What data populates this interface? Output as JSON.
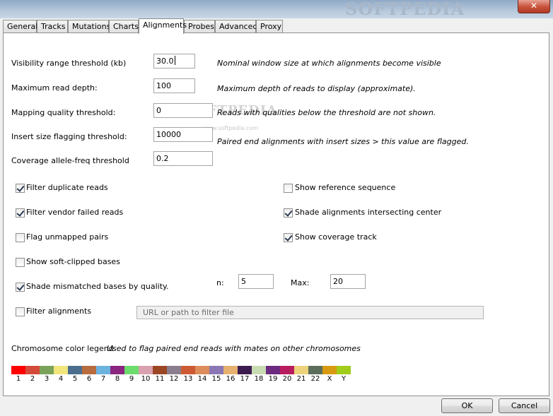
{
  "window": {
    "close_label": "✕",
    "watermark": "SOFTPEDIA"
  },
  "tabs": [
    "General",
    "Tracks",
    "Mutations",
    "Charts",
    "Alignments",
    "Probes",
    "Advanced",
    "Proxy"
  ],
  "active_tab": "Alignments",
  "fields": [
    {
      "label": "Visibility range threshold (kb)",
      "value": "30.0",
      "desc": "Nominal window size at which alignments become visible"
    },
    {
      "label": "Maximum read depth:",
      "value": "100",
      "desc": "Maximum depth of reads to display (approximate)."
    },
    {
      "label": "Mapping quality threshold:",
      "value": "0",
      "desc": "Reads with qualities below the threshold are not shown."
    },
    {
      "label": "Insert size flagging threshold:",
      "value": "10000",
      "desc": "Paired end alignments with insert sizes > this value are flagged."
    },
    {
      "label": "Coverage allele-freq threshold",
      "value": "0.2",
      "desc": ""
    }
  ],
  "checkboxes_left": [
    {
      "label": "Filter duplicate reads",
      "checked": true
    },
    {
      "label": "Filter vendor failed reads",
      "checked": true
    },
    {
      "label": "Flag unmapped pairs",
      "checked": false
    },
    {
      "label": "Show soft-clipped bases",
      "checked": false
    },
    {
      "label": "Shade mismatched bases by quality.",
      "checked": true
    },
    {
      "label": "Filter alignments",
      "checked": false
    }
  ],
  "checkboxes_right": [
    {
      "label": "Show reference sequence",
      "checked": false
    },
    {
      "label": "Shade alignments intersecting center",
      "checked": true
    },
    {
      "label": "Show coverage track",
      "checked": true
    }
  ],
  "quality": {
    "min_label_fragment": "n:",
    "min_value": "5",
    "max_label": "Max:",
    "max_value": "20"
  },
  "filter_file": {
    "placeholder": "URL or path to filter file"
  },
  "watermark_mid": {
    "text": "SOFTPEDIA",
    "url": "www.softpedia.com"
  },
  "legend": {
    "title": "Chromosome color legend",
    "desc": "Used to flag paired end reads with mates on other chromosomes",
    "chromosomes": [
      {
        "label": "1",
        "color": "#ff0000"
      },
      {
        "label": "2",
        "color": "#d44a3a"
      },
      {
        "label": "3",
        "color": "#7aa25b"
      },
      {
        "label": "4",
        "color": "#f1e57c"
      },
      {
        "label": "5",
        "color": "#4b6e8e"
      },
      {
        "label": "6",
        "color": "#b76b3e"
      },
      {
        "label": "7",
        "color": "#6cb3e0"
      },
      {
        "label": "8",
        "color": "#8a2580"
      },
      {
        "label": "9",
        "color": "#6cdc6c"
      },
      {
        "label": "10",
        "color": "#d9a0ad"
      },
      {
        "label": "11",
        "color": "#9b4624"
      },
      {
        "label": "12",
        "color": "#8a7e8e"
      },
      {
        "label": "13",
        "color": "#cc5b33"
      },
      {
        "label": "14",
        "color": "#dc8d5b"
      },
      {
        "label": "15",
        "color": "#8a77b3"
      },
      {
        "label": "16",
        "color": "#e6b06e"
      },
      {
        "label": "17",
        "color": "#3c1c4e"
      },
      {
        "label": "18",
        "color": "#c8dcb3"
      },
      {
        "label": "19",
        "color": "#6c2b80"
      },
      {
        "label": "20",
        "color": "#b81c5e"
      },
      {
        "label": "21",
        "color": "#ecd27a"
      },
      {
        "label": "22",
        "color": "#5c6e5b"
      },
      {
        "label": "X",
        "color": "#d89a10"
      },
      {
        "label": "Y",
        "color": "#a0cc1a"
      }
    ]
  },
  "buttons": {
    "ok": "OK",
    "cancel": "Cancel"
  }
}
